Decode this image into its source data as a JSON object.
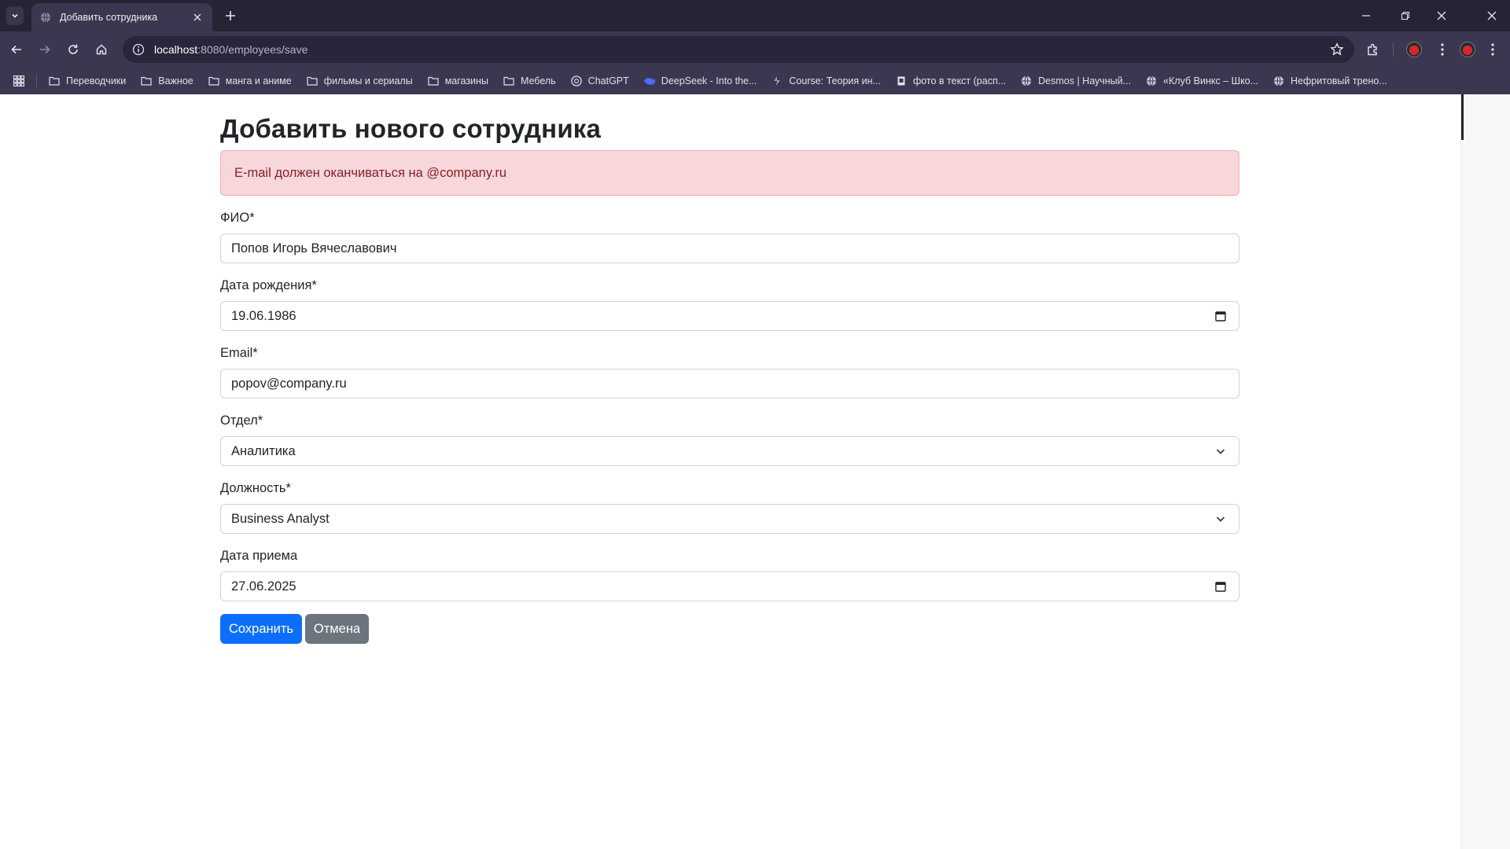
{
  "browser": {
    "tab_title": "Добавить сотрудника",
    "url_host": "localhost",
    "url_rest": ":8080/employees/save",
    "bookmarks": [
      {
        "label": "Переводчики",
        "icon": "folder-icon"
      },
      {
        "label": "Важное",
        "icon": "folder-icon"
      },
      {
        "label": "манга и аниме",
        "icon": "folder-icon"
      },
      {
        "label": "фильмы и сериалы",
        "icon": "folder-icon"
      },
      {
        "label": "магазины",
        "icon": "folder-icon"
      },
      {
        "label": "Мебель",
        "icon": "folder-icon"
      },
      {
        "label": "ChatGPT",
        "icon": "chatgpt-icon"
      },
      {
        "label": "DeepSeek - Into the...",
        "icon": "deepseek-icon"
      },
      {
        "label": "Course: Теория ин...",
        "icon": "course-icon"
      },
      {
        "label": "фото в текст (расп...",
        "icon": "photo-icon"
      },
      {
        "label": "Desmos | Научный...",
        "icon": "globe-icon"
      },
      {
        "label": "«Клуб Винкс – Шко...",
        "icon": "globe-icon"
      },
      {
        "label": "Нефритовый трено...",
        "icon": "globe-icon"
      }
    ]
  },
  "page": {
    "heading": "Добавить нового сотрудника",
    "alert": "E-mail должен оканчиваться на @company.ru",
    "fields": {
      "fio": {
        "label": "ФИО*",
        "value": "Попов Игорь Вячеславович"
      },
      "birth": {
        "label": "Дата рождения*",
        "value": "19.06.1986"
      },
      "email": {
        "label": "Email*",
        "value": "popov@company.ru"
      },
      "department": {
        "label": "Отдел*",
        "value": "Аналитика"
      },
      "position": {
        "label": "Должность*",
        "value": "Business Analyst"
      },
      "hire": {
        "label": "Дата приема",
        "value": "27.06.2025"
      }
    },
    "save_label": "Сохранить",
    "cancel_label": "Отмена"
  },
  "colors": {
    "primary": "#0d6efd",
    "secondary": "#6c757d",
    "alert_bg": "#f8d7da",
    "alert_text": "#842029",
    "chrome_bg": "#272334"
  }
}
